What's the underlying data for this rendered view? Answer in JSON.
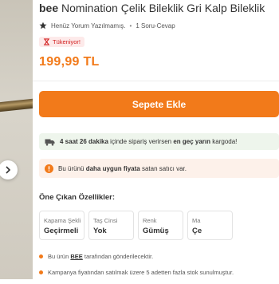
{
  "product": {
    "brand": "bee",
    "name": "Nomination Çelik Bileklik Gri Kalp Bileklik",
    "rating_text": "Henüz Yorum Yazılmamış.",
    "qa_text": "1 Soru-Cevap",
    "badge": "Tükeniyor!",
    "price": "199,99 TL"
  },
  "actions": {
    "add_to_cart": "Sepete Ekle"
  },
  "delivery": {
    "time_bold": "4 saat 26 dakika",
    "middle": "içinde sipariş verirsen",
    "eta_bold": "en geç yarın",
    "tail": "kargoda!"
  },
  "better_price": {
    "pre": "Bu ürünü",
    "bold": "daha uygun fiyata",
    "post": "satan satıcı var."
  },
  "features": {
    "title": "Öne Çıkan Özellikler:",
    "items": [
      {
        "label": "Kapama Şekli",
        "value": "Geçirmeli"
      },
      {
        "label": "Taş Cinsi",
        "value": "Yok"
      },
      {
        "label": "Renk",
        "value": "Gümüş"
      },
      {
        "label": "Ma",
        "value": "Çe"
      }
    ]
  },
  "notes": {
    "seller_pre": "Bu ürün",
    "seller_name": "BEE",
    "seller_post": "tarafından gönderilecektir.",
    "campaign": "Kampanya fiyatından satılmak üzere 5 adetten fazla stok sunulmuştur."
  },
  "colors": {
    "accent": "#f27a1a",
    "alert": "#d21f1f",
    "delivery_bg": "#eef5ec",
    "info_bg": "#fdf1ea"
  }
}
